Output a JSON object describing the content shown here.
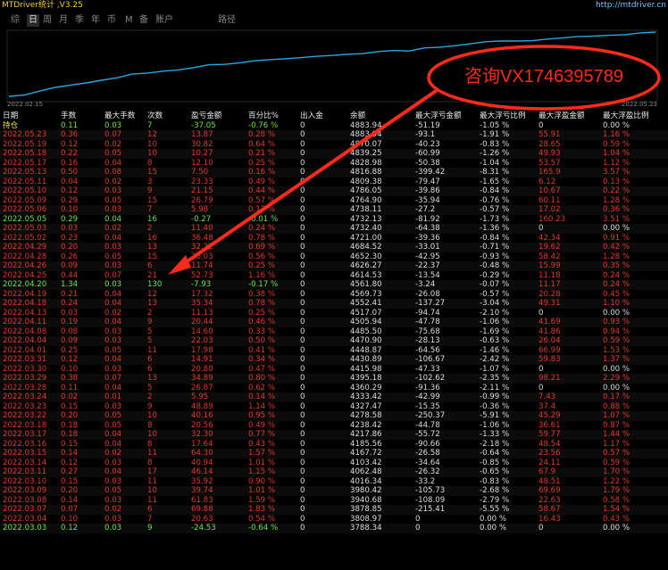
{
  "app": {
    "title": "MTDriver统计 ,V3.25",
    "url": "http://mtdriver.cn"
  },
  "tabs": [
    "综",
    "日",
    "周",
    "月",
    "季",
    "年",
    "币",
    "M",
    "备",
    "账户",
    "路径"
  ],
  "active_tab": 1,
  "chart": {
    "start_date": "2022.02.15",
    "end_date": "2022.05.23",
    "line_color": "#2aa8e0"
  },
  "promo": {
    "text": "咨询VX1746395789",
    "color": "#ff2a1a"
  },
  "table": {
    "headers": [
      "日期",
      "手数",
      "最大手数",
      "次数",
      "盈亏金额",
      "百分比%",
      "出入金",
      "余额",
      "最大浮亏金额",
      "最大浮亏比例",
      "最大浮盈金额",
      "最大浮盈比例"
    ],
    "rows": [
      {
        "c": [
          "持仓",
          "0.11",
          "0.03",
          "7",
          "-37.05",
          "-0.76 %",
          "0",
          "4883.94",
          "-51.19",
          "-1.05 %",
          "0",
          "0.00 %"
        ],
        "t": "gold"
      },
      {
        "c": [
          "2022.05.23",
          "0.36",
          "0.07",
          "12",
          "13.87",
          "0.28 %",
          "0",
          "4883.94",
          "-93.1",
          "-1.91 %",
          "55.91",
          "1.16 %"
        ],
        "t": "red"
      },
      {
        "c": [
          "2022.05.19",
          "0.12",
          "0.02",
          "10",
          "30.82",
          "0.64 %",
          "0",
          "4870.07",
          "-40.23",
          "-0.83 %",
          "28.65",
          "0.59 %"
        ],
        "t": "red"
      },
      {
        "c": [
          "2022.05.18",
          "0.22",
          "0.05",
          "10",
          "10.27",
          "0.21 %",
          "0",
          "4839.25",
          "-60.99",
          "-1.26 %",
          "49.93",
          "1.04 %"
        ],
        "t": "red"
      },
      {
        "c": [
          "2022.05.17",
          "0.16",
          "0.04",
          "8",
          "12.10",
          "0.25 %",
          "0",
          "4828.98",
          "-50.38",
          "-1.04 %",
          "53.57",
          "1.12 %"
        ],
        "t": "red"
      },
      {
        "c": [
          "2022.05.13",
          "0.50",
          "0.08",
          "15",
          "7.50",
          "0.16 %",
          "0",
          "4816.88",
          "-399.42",
          "-8.31 %",
          "165.9",
          "3.57 %"
        ],
        "t": "red"
      },
      {
        "c": [
          "2022.05.11",
          "0.04",
          "0.02",
          "3",
          "23.33",
          "0.49 %",
          "0",
          "4809.38",
          "-79.47",
          "-1.65 %",
          "6.12",
          "0.13 %"
        ],
        "t": "red"
      },
      {
        "c": [
          "2022.05.10",
          "0.12",
          "0.03",
          "9",
          "21.15",
          "0.44 %",
          "0",
          "4786.05",
          "-39.86",
          "-0.84 %",
          "10.67",
          "0.22 %"
        ],
        "t": "red"
      },
      {
        "c": [
          "2022.05.09",
          "0.29",
          "0.05",
          "15",
          "26.79",
          "0.57 %",
          "0",
          "4764.90",
          "-35.94",
          "-0.76 %",
          "60.11",
          "1.28 %"
        ],
        "t": "red"
      },
      {
        "c": [
          "2022.05.06",
          "0.10",
          "0.03",
          "7",
          "5.98",
          "0.13 %",
          "0",
          "4738.11",
          "-27.2",
          "-0.57 %",
          "17.02",
          "0.36 %"
        ],
        "t": "red"
      },
      {
        "c": [
          "2022.05.05",
          "0.29",
          "0.04",
          "16",
          "-0.27",
          "-0.01 %",
          "0",
          "4732.13",
          "-81.92",
          "-1.73 %",
          "160.23",
          "3.51 %"
        ],
        "t": "green"
      },
      {
        "c": [
          "2022.05.03",
          "0.03",
          "0.02",
          "2",
          "11.40",
          "0.24 %",
          "0",
          "4732.40",
          "-64.38",
          "-1.36 %",
          "0",
          "0.00 %"
        ],
        "t": "red"
      },
      {
        "c": [
          "2022.05.02",
          "0.23",
          "0.04",
          "16",
          "36.48",
          "0.78 %",
          "0",
          "4721.00",
          "-39.36",
          "-0.84 %",
          "42.34",
          "0.91 %"
        ],
        "t": "red"
      },
      {
        "c": [
          "2022.04.29",
          "0.20",
          "0.03",
          "13",
          "32.22",
          "0.69 %",
          "0",
          "4684.52",
          "-33.01",
          "-0.71 %",
          "19.62",
          "0.42 %"
        ],
        "t": "red"
      },
      {
        "c": [
          "2022.04.28",
          "0.26",
          "0.05",
          "15",
          "26.03",
          "0.56 %",
          "0",
          "4652.30",
          "-42.95",
          "-0.93 %",
          "58.42",
          "1.28 %"
        ],
        "t": "red"
      },
      {
        "c": [
          "2022.04.26",
          "0.09",
          "0.03",
          "6",
          "11.74",
          "0.25 %",
          "0",
          "4626.27",
          "-22.37",
          "-0.48 %",
          "15.99",
          "0.35 %"
        ],
        "t": "red"
      },
      {
        "c": [
          "2022.04.25",
          "0.44",
          "0.07",
          "21",
          "52.73",
          "1.16 %",
          "0",
          "4614.53",
          "-13.54",
          "-0.29 %",
          "11.18",
          "0.24 %"
        ],
        "t": "red"
      },
      {
        "c": [
          "2022.04.20",
          "1.34",
          "0.03",
          "130",
          "-7.93",
          "-0.17 %",
          "0",
          "4561.80",
          "-3.24",
          "-0.07 %",
          "11.17",
          "0.24 %"
        ],
        "t": "green"
      },
      {
        "c": [
          "2022.04.19",
          "0.21",
          "0.04",
          "12",
          "17.32",
          "0.38 %",
          "0",
          "4569.73",
          "-26.08",
          "-0.57 %",
          "20.28",
          "0.45 %"
        ],
        "t": "red"
      },
      {
        "c": [
          "2022.04.18",
          "0.24",
          "0.04",
          "13",
          "35.34",
          "0.78 %",
          "0",
          "4552.41",
          "-137.27",
          "-3.04 %",
          "49.31",
          "1.10 %"
        ],
        "t": "red"
      },
      {
        "c": [
          "2022.04.13",
          "0.03",
          "0.02",
          "2",
          "11.13",
          "0.25 %",
          "0",
          "4517.07",
          "-94.74",
          "-2.10 %",
          "0",
          "0.00 %"
        ],
        "t": "red"
      },
      {
        "c": [
          "2022.04.11",
          "0.19",
          "0.04",
          "9",
          "20.44",
          "0.46 %",
          "0",
          "4505.94",
          "-47.78",
          "-1.06 %",
          "41.69",
          "0.93 %"
        ],
        "t": "red"
      },
      {
        "c": [
          "2022.04.08",
          "0.08",
          "0.03",
          "5",
          "14.60",
          "0.33 %",
          "0",
          "4485.50",
          "-75.68",
          "-1.69 %",
          "41.86",
          "0.94 %"
        ],
        "t": "red"
      },
      {
        "c": [
          "2022.04.04",
          "0.09",
          "0.03",
          "5",
          "22.03",
          "0.50 %",
          "0",
          "4470.90",
          "-28.13",
          "-0.63 %",
          "26.04",
          "0.59 %"
        ],
        "t": "red"
      },
      {
        "c": [
          "2022.04.01",
          "0.25",
          "0.05",
          "11",
          "17.98",
          "0.41 %",
          "0",
          "4448.87",
          "-64.56",
          "-1.46 %",
          "66.99",
          "1.53 %"
        ],
        "t": "red"
      },
      {
        "c": [
          "2022.03.31",
          "0.12",
          "0.04",
          "6",
          "14.91",
          "0.34 %",
          "0",
          "4430.89",
          "-106.67",
          "-2.42 %",
          "59.83",
          "1.37 %"
        ],
        "t": "red"
      },
      {
        "c": [
          "2022.03.30",
          "0.10",
          "0.03",
          "6",
          "20.80",
          "0.47 %",
          "0",
          "4415.98",
          "-47.33",
          "-1.07 %",
          "0",
          "0.00 %"
        ],
        "t": "red"
      },
      {
        "c": [
          "2022.03.29",
          "0.38",
          "0.07",
          "13",
          "34.89",
          "0.80 %",
          "0",
          "4395.18",
          "-102.62",
          "-2.35 %",
          "98.21",
          "2.29 %"
        ],
        "t": "red"
      },
      {
        "c": [
          "2022.03.28",
          "0.11",
          "0.04",
          "5",
          "26.87",
          "0.62 %",
          "0",
          "4360.29",
          "-91.36",
          "-2.11 %",
          "0",
          "0.00 %"
        ],
        "t": "red"
      },
      {
        "c": [
          "2022.03.24",
          "0.02",
          "0.01",
          "2",
          "5.95",
          "0.14 %",
          "0",
          "4333.42",
          "-42.99",
          "-0.99 %",
          "7.43",
          "0.17 %"
        ],
        "t": "red"
      },
      {
        "c": [
          "2022.03.23",
          "0.15",
          "0.03",
          "9",
          "48.89",
          "1.14 %",
          "0",
          "4327.47",
          "-15.35",
          "-0.36 %",
          "37.4",
          "0.88 %"
        ],
        "t": "red"
      },
      {
        "c": [
          "2022.03.22",
          "0.20",
          "0.05",
          "10",
          "40.16",
          "0.95 %",
          "0",
          "4278.58",
          "-250.37",
          "-5.91 %",
          "45.29",
          "1.07 %"
        ],
        "t": "red"
      },
      {
        "c": [
          "2022.03.18",
          "0.18",
          "0.05",
          "8",
          "20.56",
          "0.49 %",
          "0",
          "4238.42",
          "-44.78",
          "-1.06 %",
          "36.61",
          "0.87 %"
        ],
        "t": "red"
      },
      {
        "c": [
          "2022.03.17",
          "0.18",
          "0.04",
          "10",
          "32.30",
          "0.77 %",
          "0",
          "4217.86",
          "-55.72",
          "-1.33 %",
          "59.77",
          "1.44 %"
        ],
        "t": "red"
      },
      {
        "c": [
          "2022.03.16",
          "0.15",
          "0.04",
          "8",
          "17.64",
          "0.43 %",
          "0",
          "4185.56",
          "-90.66",
          "-2.18 %",
          "48.54",
          "1.17 %"
        ],
        "t": "red"
      },
      {
        "c": [
          "2022.03.15",
          "0.14",
          "0.02",
          "11",
          "64.30",
          "1.57 %",
          "0",
          "4167.72",
          "-26.58",
          "-0.64 %",
          "23.56",
          "0.57 %"
        ],
        "t": "red"
      },
      {
        "c": [
          "2022.03.14",
          "0.12",
          "0.03",
          "8",
          "40.94",
          "1.01 %",
          "0",
          "4103.42",
          "-34.64",
          "-0.85 %",
          "24.11",
          "0.59 %"
        ],
        "t": "red"
      },
      {
        "c": [
          "2022.03.11",
          "0.27",
          "0.04",
          "17",
          "46.14",
          "1.15 %",
          "0",
          "4062.48",
          "-26.32",
          "-0.65 %",
          "67.9",
          "1.70 %"
        ],
        "t": "red"
      },
      {
        "c": [
          "2022.03.10",
          "0.15",
          "0.03",
          "11",
          "35.92",
          "0.90 %",
          "0",
          "4016.34",
          "-33.2",
          "-0.83 %",
          "48.51",
          "1.22 %"
        ],
        "t": "red"
      },
      {
        "c": [
          "2022.03.09",
          "0.20",
          "0.05",
          "10",
          "39.74",
          "1.01 %",
          "0",
          "3980.42",
          "-105.73",
          "-2.68 %",
          "69.69",
          "1.79 %"
        ],
        "t": "red"
      },
      {
        "c": [
          "2022.03.08",
          "0.14",
          "0.03",
          "11",
          "61.83",
          "1.59 %",
          "0",
          "3940.68",
          "-108.09",
          "-2.79 %",
          "22.63",
          "0.58 %"
        ],
        "t": "red"
      },
      {
        "c": [
          "2022.03.07",
          "0.07",
          "0.02",
          "6",
          "69.88",
          "1.83 %",
          "0",
          "3878.85",
          "-215.41",
          "-5.55 %",
          "58.67",
          "1.54 %"
        ],
        "t": "red"
      },
      {
        "c": [
          "2022.03.04",
          "0.10",
          "0.03",
          "7",
          "20.63",
          "0.54 %",
          "0",
          "3808.97",
          "0",
          "0.00 %",
          "16.43",
          "0.43 %"
        ],
        "t": "red"
      },
      {
        "c": [
          "2022.03.03",
          "0.12",
          "0.03",
          "9",
          "-24.53",
          "-0.64 %",
          "0",
          "3788.34",
          "0",
          "0.00 %",
          "0",
          "0.00 %"
        ],
        "t": "green"
      }
    ]
  }
}
